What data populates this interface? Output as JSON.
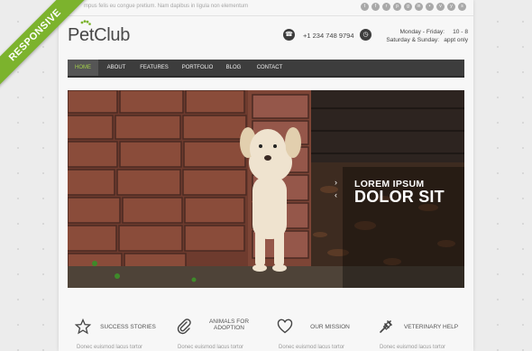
{
  "topbar": {
    "tagline": "mpus felis eu congue pretium. Nam dapibus in ligula non elementum",
    "social": [
      {
        "icon": "twitter-icon",
        "glyph": "t"
      },
      {
        "icon": "facebook-icon",
        "glyph": "f"
      },
      {
        "icon": "rss-icon",
        "glyph": "r"
      },
      {
        "icon": "pinterest-icon",
        "glyph": "p"
      },
      {
        "icon": "googleplus-icon",
        "glyph": "g"
      },
      {
        "icon": "linkedin-icon",
        "glyph": "in"
      },
      {
        "icon": "flickr-icon",
        "glyph": "•"
      },
      {
        "icon": "vimeo-icon",
        "glyph": "v"
      },
      {
        "icon": "youtube-icon",
        "glyph": "y"
      },
      {
        "icon": "skype-icon",
        "glyph": "s"
      }
    ]
  },
  "header": {
    "logo_pet": "Pet",
    "logo_club": "Club",
    "phone": "+1 234 748 9794",
    "hours": {
      "days1": "Monday - Friday:",
      "time1": "10 - 8",
      "days2": "Saturday & Sunday:",
      "time2": "appt only"
    }
  },
  "nav": {
    "items": [
      {
        "label": "HOME",
        "active": true
      },
      {
        "label": "ABOUT"
      },
      {
        "label": "FEATURES"
      },
      {
        "label": "PORTFOLIO"
      },
      {
        "label": "BLOG"
      },
      {
        "label": "CONTACT"
      }
    ]
  },
  "slider": {
    "caption_line1": "LOREM IPSUM",
    "caption_line2": "DOLOR SIT",
    "next": "›",
    "prev": "‹"
  },
  "features": [
    {
      "icon": "star-icon",
      "label": "SUCCESS STORIES",
      "text": "Donec euismod lacus tortor"
    },
    {
      "icon": "paperclip-icon",
      "label": "ANIMALS FOR ADOPTION",
      "text": "Donec euismod lacus tortor"
    },
    {
      "icon": "heart-icon",
      "label": "OUR MISSION",
      "text": "Donec euismod lacus tortor"
    },
    {
      "icon": "vet-icon",
      "label": "VETERINARY HELP",
      "text": "Donec euismod lacus tortor"
    }
  ],
  "ribbon": {
    "label": "RESPONSIVE"
  },
  "colors": {
    "accent": "#7cb32d",
    "nav": "#3d3d3d",
    "active_text": "#a4d14a"
  }
}
